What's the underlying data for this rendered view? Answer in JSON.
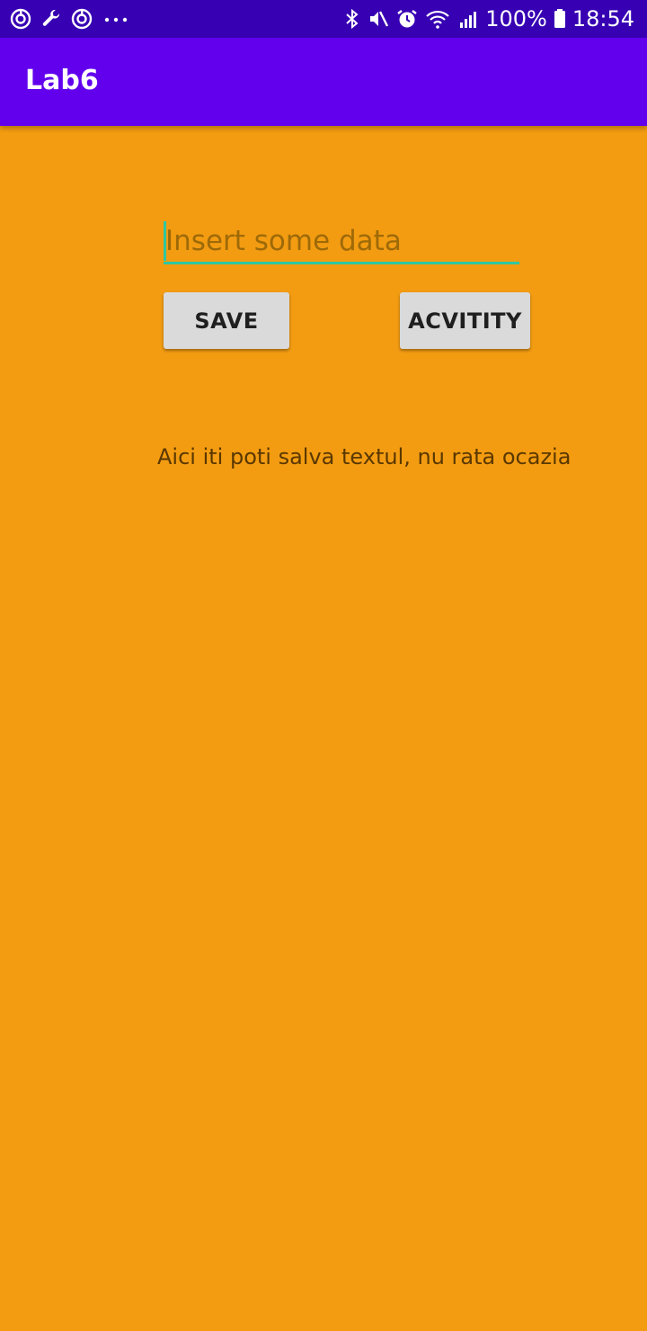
{
  "status_bar": {
    "left_icons": [
      "app-timer-icon",
      "wrench-icon",
      "app-timer-icon-2",
      "more-notifications-icon"
    ],
    "right_icons": [
      "bluetooth-icon",
      "mute-icon",
      "alarm-icon",
      "wifi-icon",
      "signal-icon"
    ],
    "battery": "100%",
    "time": "18:54",
    "background": "#3700B3"
  },
  "app_bar": {
    "title": "Lab6",
    "background": "#6200EE"
  },
  "main": {
    "background": "#F39C12",
    "input": {
      "placeholder": "Insert some data",
      "value": "",
      "accent": "#2FC7A0"
    },
    "buttons": {
      "save_label": "SAVE",
      "activity_label": "ACVITITY"
    },
    "message": "Aici iti poti salva textul, nu rata ocazia"
  }
}
